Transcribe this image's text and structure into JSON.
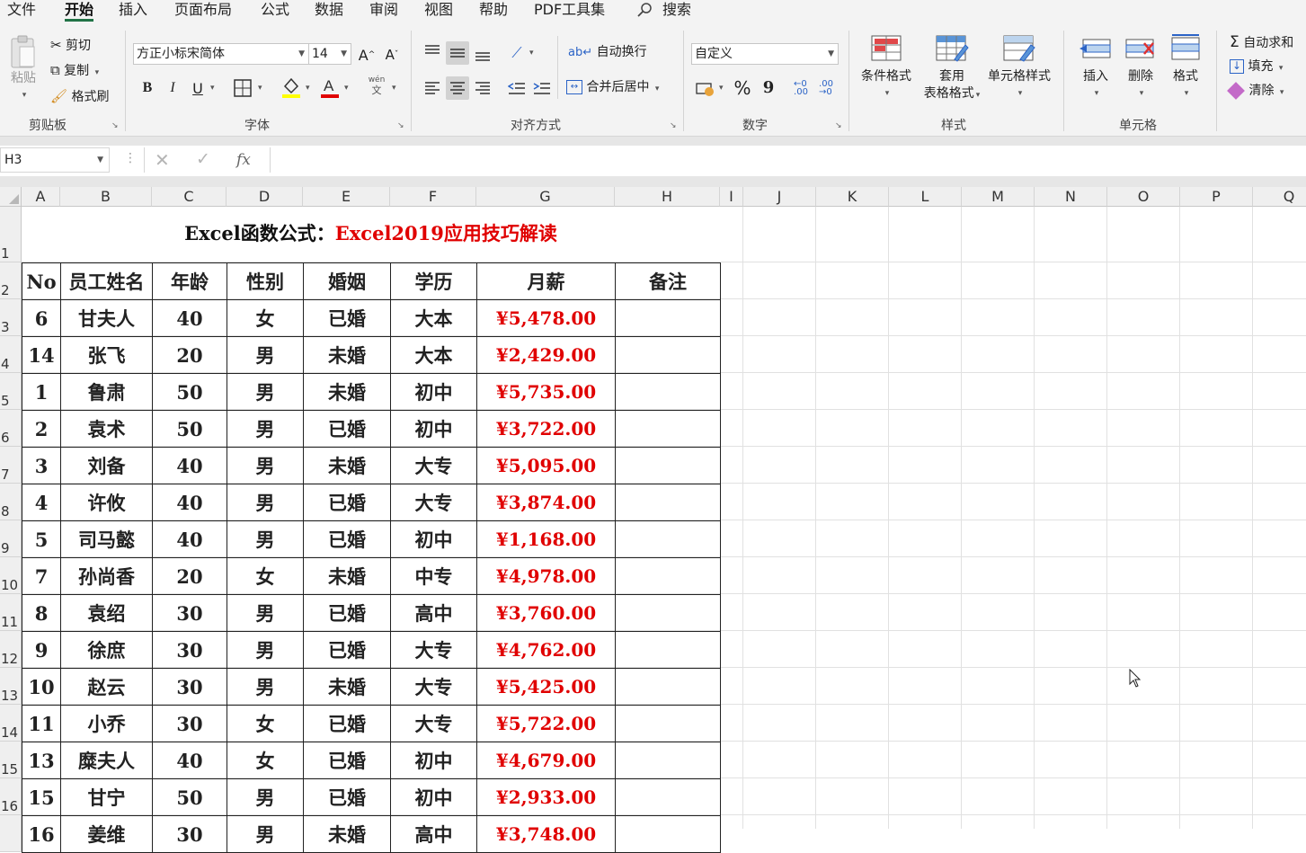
{
  "menu": {
    "tabs": [
      "文件",
      "开始",
      "插入",
      "页面布局",
      "公式",
      "数据",
      "审阅",
      "视图",
      "帮助",
      "PDF工具集"
    ],
    "active_tab": "开始",
    "search_label": "搜索"
  },
  "ribbon": {
    "clipboard": {
      "paste": "粘贴",
      "cut": "剪切",
      "copy": "复制",
      "format_painter": "格式刷",
      "group_label": "剪贴板"
    },
    "font": {
      "font_name": "方正小标宋简体",
      "font_size": "14",
      "grow": "A",
      "shrink": "A",
      "bold": "B",
      "italic": "I",
      "underline": "U",
      "fill_color": "#ffff00",
      "font_color_value": "#e00000",
      "phonetic_top": "wén",
      "phonetic_bottom": "文",
      "group_label": "字体"
    },
    "alignment": {
      "wrap_text": "自动换行",
      "merge_center": "合并后居中",
      "group_label": "对齐方式"
    },
    "number": {
      "format": "自定义",
      "percent": "%",
      "comma": "9",
      "group_label": "数字"
    },
    "styles": {
      "conditional": "条件格式",
      "table_format_l1": "套用",
      "table_format_l2": "表格格式",
      "cell_styles": "单元格样式",
      "group_label": "样式"
    },
    "cells": {
      "insert": "插入",
      "delete": "删除",
      "format": "格式",
      "group_label": "单元格"
    },
    "editing": {
      "autosum": "自动求和",
      "fill": "填充",
      "clear": "清除"
    }
  },
  "formula_bar": {
    "name_box": "H3",
    "fx": "fx",
    "formula": ""
  },
  "columns": [
    "A",
    "B",
    "C",
    "D",
    "E",
    "F",
    "G",
    "H",
    "I",
    "J",
    "K",
    "L",
    "M",
    "N",
    "O",
    "P",
    "Q"
  ],
  "rows": [
    "1",
    "2",
    "3",
    "4",
    "5",
    "6",
    "7",
    "8",
    "9",
    "10",
    "11",
    "12",
    "13",
    "14",
    "15",
    "16"
  ],
  "sheet": {
    "title_black": "Excel函数公式：",
    "title_red": "Excel2019应用技巧解读",
    "headers": [
      "No",
      "员工姓名",
      "年龄",
      "性别",
      "婚姻",
      "学历",
      "月薪",
      "备注"
    ],
    "data_rows": [
      [
        "6",
        "甘夫人",
        "40",
        "女",
        "已婚",
        "大本",
        "¥5,478.00",
        ""
      ],
      [
        "14",
        "张飞",
        "20",
        "男",
        "未婚",
        "大本",
        "¥2,429.00",
        ""
      ],
      [
        "1",
        "鲁肃",
        "50",
        "男",
        "未婚",
        "初中",
        "¥5,735.00",
        ""
      ],
      [
        "2",
        "袁术",
        "50",
        "男",
        "已婚",
        "初中",
        "¥3,722.00",
        ""
      ],
      [
        "3",
        "刘备",
        "40",
        "男",
        "未婚",
        "大专",
        "¥5,095.00",
        ""
      ],
      [
        "4",
        "许攸",
        "40",
        "男",
        "已婚",
        "大专",
        "¥3,874.00",
        ""
      ],
      [
        "5",
        "司马懿",
        "40",
        "男",
        "已婚",
        "初中",
        "¥1,168.00",
        ""
      ],
      [
        "7",
        "孙尚香",
        "20",
        "女",
        "未婚",
        "中专",
        "¥4,978.00",
        ""
      ],
      [
        "8",
        "袁绍",
        "30",
        "男",
        "已婚",
        "高中",
        "¥3,760.00",
        ""
      ],
      [
        "9",
        "徐庶",
        "30",
        "男",
        "已婚",
        "大专",
        "¥4,762.00",
        ""
      ],
      [
        "10",
        "赵云",
        "30",
        "男",
        "未婚",
        "大专",
        "¥5,425.00",
        ""
      ],
      [
        "11",
        "小乔",
        "30",
        "女",
        "已婚",
        "大专",
        "¥5,722.00",
        ""
      ],
      [
        "13",
        "糜夫人",
        "40",
        "女",
        "已婚",
        "初中",
        "¥4,679.00",
        ""
      ],
      [
        "15",
        "甘宁",
        "50",
        "男",
        "已婚",
        "初中",
        "¥2,933.00",
        ""
      ],
      [
        "16",
        "姜维",
        "30",
        "男",
        "未婚",
        "高中",
        "¥3,748.00",
        ""
      ]
    ]
  }
}
